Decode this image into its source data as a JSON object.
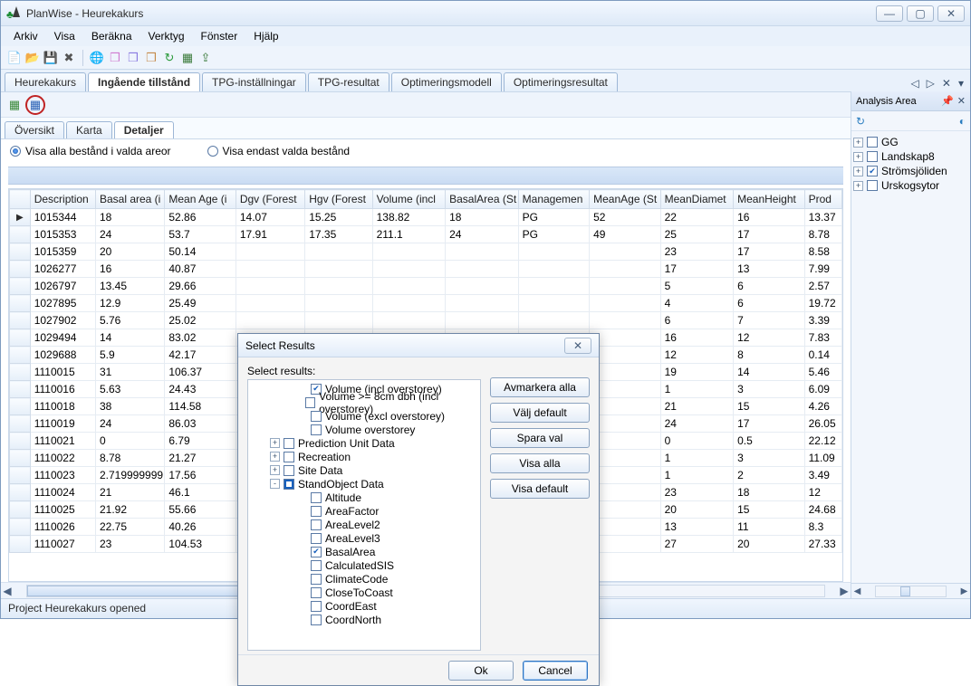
{
  "app": {
    "title": "PlanWise - Heurekakurs"
  },
  "menus": [
    "Arkiv",
    "Visa",
    "Beräkna",
    "Verktyg",
    "Fönster",
    "Hjälp"
  ],
  "toolbar_icons": [
    {
      "name": "new-icon",
      "glyph": "📄",
      "color": "#6a8"
    },
    {
      "name": "open-icon",
      "glyph": "📂",
      "color": "#d9a23a"
    },
    {
      "name": "save-icon",
      "glyph": "💾",
      "color": "#7a91ab"
    },
    {
      "name": "delete-icon",
      "glyph": "✖",
      "color": "#555"
    },
    {
      "name": "sep"
    },
    {
      "name": "globe-icon",
      "glyph": "🌐",
      "color": "#2a7dc0"
    },
    {
      "name": "cube1-icon",
      "glyph": "❒",
      "color": "#d07ad0"
    },
    {
      "name": "cube2-icon",
      "glyph": "❒",
      "color": "#8a7ae0"
    },
    {
      "name": "cube3-icon",
      "glyph": "❒",
      "color": "#c58a4a"
    },
    {
      "name": "refresh-icon",
      "glyph": "↻",
      "color": "#2a9a3a"
    },
    {
      "name": "table-icon",
      "glyph": "▦",
      "color": "#3a7a3a"
    },
    {
      "name": "export-icon",
      "glyph": "⇪",
      "color": "#3a7a3a"
    }
  ],
  "maintabs": [
    {
      "label": "Heurekakurs",
      "active": false
    },
    {
      "label": "Ingående tillstånd",
      "active": true
    },
    {
      "label": "TPG-inställningar",
      "active": false
    },
    {
      "label": "TPG-resultat",
      "active": false
    },
    {
      "label": "Optimeringsmodell",
      "active": false
    },
    {
      "label": "Optimeringsresultat",
      "active": false
    }
  ],
  "subtoolbar_icons": [
    "add-icon",
    "grid-icon"
  ],
  "subtabs": [
    {
      "label": "Översikt",
      "active": false
    },
    {
      "label": "Karta",
      "active": false
    },
    {
      "label": "Detaljer",
      "active": true
    }
  ],
  "radios": {
    "opt1": "Visa alla bestånd i valda areor",
    "opt2": "Visa endast valda bestånd",
    "selected": "opt1"
  },
  "grid": {
    "columns": [
      "Description",
      "Basal area (i",
      "Mean Age (i",
      "Dgv (Forest",
      "Hgv (Forest",
      "Volume (incl",
      "BasalArea (St",
      "Managemen",
      "MeanAge (St",
      "MeanDiamet",
      "MeanHeight",
      "Prod"
    ],
    "rows": [
      [
        "1015344",
        "18",
        "52.86",
        "14.07",
        "15.25",
        "138.82",
        "18",
        "PG",
        "52",
        "22",
        "16",
        "13.37"
      ],
      [
        "1015353",
        "24",
        "53.7",
        "17.91",
        "17.35",
        "211.1",
        "24",
        "PG",
        "49",
        "25",
        "17",
        "8.78"
      ],
      [
        "1015359",
        "20",
        "50.14",
        "",
        "",
        "",
        "",
        "",
        "",
        "23",
        "17",
        "8.58"
      ],
      [
        "1026277",
        "16",
        "40.87",
        "",
        "",
        "",
        "",
        "",
        "",
        "17",
        "13",
        "7.99"
      ],
      [
        "1026797",
        "13.45",
        "29.66",
        "",
        "",
        "",
        "",
        "",
        "",
        "5",
        "6",
        "2.57"
      ],
      [
        "1027895",
        "12.9",
        "25.49",
        "",
        "",
        "",
        "",
        "",
        "",
        "4",
        "6",
        "19.72"
      ],
      [
        "1027902",
        "5.76",
        "25.02",
        "",
        "",
        "",
        "",
        "",
        "",
        "6",
        "7",
        "3.39"
      ],
      [
        "1029494",
        "14",
        "83.02",
        "",
        "",
        "",
        "",
        "",
        "",
        "16",
        "12",
        "7.83"
      ],
      [
        "1029688",
        "5.9",
        "42.17",
        "",
        "",
        "",
        "",
        "",
        "",
        "12",
        "8",
        "0.14"
      ],
      [
        "1110015",
        "31",
        "106.37",
        "",
        "",
        "",
        "",
        "",
        "",
        "19",
        "14",
        "5.46"
      ],
      [
        "1110016",
        "5.63",
        "24.43",
        "",
        "",
        "",
        "",
        "",
        "",
        "1",
        "3",
        "6.09"
      ],
      [
        "1110018",
        "38",
        "114.58",
        "",
        "",
        "",
        "",
        "",
        "",
        "21",
        "15",
        "4.26"
      ],
      [
        "1110019",
        "24",
        "86.03",
        "",
        "",
        "",
        "",
        "",
        "",
        "24",
        "17",
        "26.05"
      ],
      [
        "1110021",
        "0",
        "6.79",
        "",
        "",
        "",
        "",
        "",
        "",
        "0",
        "0.5",
        "22.12"
      ],
      [
        "1110022",
        "8.78",
        "21.27",
        "",
        "",
        "",
        "",
        "",
        "",
        "1",
        "3",
        "11.09"
      ],
      [
        "1110023",
        "2.719999999",
        "17.56",
        "",
        "",
        "",
        "",
        "",
        "",
        "1",
        "2",
        "3.49"
      ],
      [
        "1110024",
        "21",
        "46.1",
        "",
        "",
        "",
        "",
        "",
        "",
        "23",
        "18",
        "12"
      ],
      [
        "1110025",
        "21.92",
        "55.66",
        "",
        "",
        "",
        "",
        "",
        "",
        "20",
        "15",
        "24.68"
      ],
      [
        "1110026",
        "22.75",
        "40.26",
        "",
        "",
        "",
        "",
        "",
        "",
        "13",
        "11",
        "8.3"
      ],
      [
        "1110027",
        "23",
        "104.53",
        "",
        "",
        "",
        "",
        "",
        "",
        "27",
        "20",
        "27.33"
      ]
    ]
  },
  "status": "Project Heurekakurs opened",
  "side": {
    "title": "Analysis Area",
    "items": [
      {
        "label": "GG",
        "checked": false
      },
      {
        "label": "Landskap8",
        "checked": false
      },
      {
        "label": "Strömsjöliden",
        "checked": true
      },
      {
        "label": "Urskogsytor",
        "checked": false
      }
    ]
  },
  "dialog": {
    "title": "Select Results",
    "label": "Select results:",
    "buttons": [
      "Avmarkera alla",
      "Välj default",
      "Spara val",
      "Visa alla",
      "Visa default"
    ],
    "ok": "Ok",
    "cancel": "Cancel",
    "tree": [
      {
        "depth": 2,
        "exp": "",
        "cb": "on",
        "label": "Volume (incl overstorey)"
      },
      {
        "depth": 2,
        "exp": "",
        "cb": "off",
        "label": "Volume >= 8cm dbh (incl overstorey)"
      },
      {
        "depth": 2,
        "exp": "",
        "cb": "off",
        "label": "Volume (excl overstorey)"
      },
      {
        "depth": 2,
        "exp": "",
        "cb": "off",
        "label": "Volume overstorey"
      },
      {
        "depth": 0,
        "exp": "+",
        "cb": "off",
        "label": "Prediction Unit Data"
      },
      {
        "depth": 0,
        "exp": "+",
        "cb": "off",
        "label": "Recreation"
      },
      {
        "depth": 0,
        "exp": "+",
        "cb": "off",
        "label": "Site Data"
      },
      {
        "depth": 0,
        "exp": "-",
        "cb": "tri",
        "label": "StandObject Data"
      },
      {
        "depth": 2,
        "exp": "",
        "cb": "off",
        "label": "Altitude"
      },
      {
        "depth": 2,
        "exp": "",
        "cb": "off",
        "label": "AreaFactor"
      },
      {
        "depth": 2,
        "exp": "",
        "cb": "off",
        "label": "AreaLevel2"
      },
      {
        "depth": 2,
        "exp": "",
        "cb": "off",
        "label": "AreaLevel3"
      },
      {
        "depth": 2,
        "exp": "",
        "cb": "on",
        "label": "BasalArea"
      },
      {
        "depth": 2,
        "exp": "",
        "cb": "off",
        "label": "CalculatedSIS"
      },
      {
        "depth": 2,
        "exp": "",
        "cb": "off",
        "label": "ClimateCode"
      },
      {
        "depth": 2,
        "exp": "",
        "cb": "off",
        "label": "CloseToCoast"
      },
      {
        "depth": 2,
        "exp": "",
        "cb": "off",
        "label": "CoordEast"
      },
      {
        "depth": 2,
        "exp": "",
        "cb": "off",
        "label": "CoordNorth"
      }
    ]
  }
}
